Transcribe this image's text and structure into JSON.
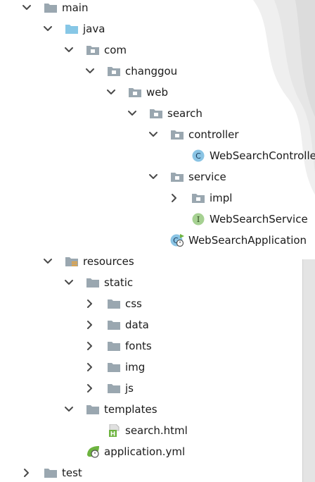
{
  "tree": {
    "items": [
      {
        "label": "main",
        "icon": "folder-gray-icon",
        "chevron": "expanded",
        "depth": 0
      },
      {
        "label": "java",
        "icon": "folder-blue-icon",
        "chevron": "expanded",
        "depth": 1
      },
      {
        "label": "com",
        "icon": "package-icon",
        "chevron": "expanded",
        "depth": 2
      },
      {
        "label": "changgou",
        "icon": "package-icon",
        "chevron": "expanded",
        "depth": 3
      },
      {
        "label": "web",
        "icon": "package-icon",
        "chevron": "expanded",
        "depth": 4
      },
      {
        "label": "search",
        "icon": "package-icon",
        "chevron": "expanded",
        "depth": 5
      },
      {
        "label": "controller",
        "icon": "package-icon",
        "chevron": "expanded",
        "depth": 6
      },
      {
        "label": "WebSearchController",
        "icon": "class-icon",
        "chevron": "none",
        "depth": 7
      },
      {
        "label": "service",
        "icon": "package-icon",
        "chevron": "expanded",
        "depth": 6
      },
      {
        "label": "impl",
        "icon": "package-icon",
        "chevron": "collapsed",
        "depth": 7
      },
      {
        "label": "WebSearchService",
        "icon": "interface-icon",
        "chevron": "none",
        "depth": 7
      },
      {
        "label": "WebSearchApplication",
        "icon": "spring-boot-class-icon",
        "chevron": "none",
        "depth": 6
      },
      {
        "label": "resources",
        "icon": "resources-folder-icon",
        "chevron": "expanded",
        "depth": 1
      },
      {
        "label": "static",
        "icon": "folder-gray-icon",
        "chevron": "expanded",
        "depth": 2
      },
      {
        "label": "css",
        "icon": "folder-gray-icon",
        "chevron": "collapsed",
        "depth": 3
      },
      {
        "label": "data",
        "icon": "folder-gray-icon",
        "chevron": "collapsed",
        "depth": 3
      },
      {
        "label": "fonts",
        "icon": "folder-gray-icon",
        "chevron": "collapsed",
        "depth": 3
      },
      {
        "label": "img",
        "icon": "folder-gray-icon",
        "chevron": "collapsed",
        "depth": 3
      },
      {
        "label": "js",
        "icon": "folder-gray-icon",
        "chevron": "collapsed",
        "depth": 3
      },
      {
        "label": "templates",
        "icon": "folder-gray-icon",
        "chevron": "expanded",
        "depth": 2
      },
      {
        "label": "search.html",
        "icon": "html-file-icon",
        "chevron": "none",
        "depth": 3
      },
      {
        "label": "application.yml",
        "icon": "spring-yml-icon",
        "chevron": "none",
        "depth": 2
      },
      {
        "label": "test",
        "icon": "folder-gray-icon",
        "chevron": "collapsed",
        "depth": 0
      }
    ]
  },
  "colors": {
    "folder_gray": "#9aa7b0",
    "folder_blue": "#87c7e6",
    "class_circle": "#8ac4e4",
    "interface_circle": "#a6d192",
    "spring_green": "#6db33f",
    "chevron": "#4a4a4a"
  }
}
